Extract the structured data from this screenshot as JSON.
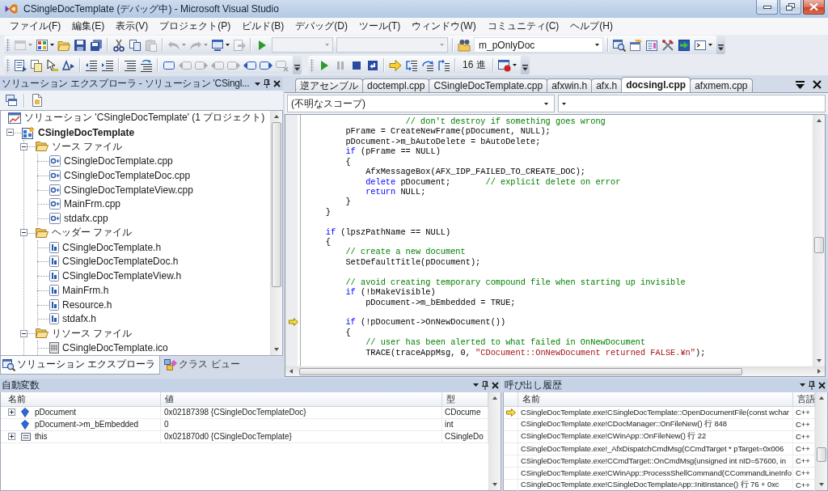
{
  "window": {
    "title": "CSingleDocTemplate (デバッグ中) - Microsoft Visual Studio"
  },
  "menu": [
    "ファイル(F)",
    "編集(E)",
    "表示(V)",
    "プロジェクト(P)",
    "ビルド(B)",
    "デバッグ(D)",
    "ツール(T)",
    "ウィンドウ(W)",
    "コミュニティ(C)",
    "ヘルプ(H)"
  ],
  "toolbar_rows": [
    {
      "toolbars": [
        {
          "items": [
            {
              "kind": "button",
              "disabled": true,
              "dropdown": true
            },
            {
              "kind": "button",
              "disabled": false,
              "dropdown": true
            },
            {
              "kind": "button",
              "disabled": false
            },
            {
              "kind": "button",
              "disabled": false
            },
            {
              "kind": "button",
              "disabled": false
            },
            {
              "kind": "separator"
            },
            {
              "kind": "button",
              "disabled": false
            },
            {
              "kind": "button",
              "disabled": false
            },
            {
              "kind": "button",
              "disabled": true
            },
            {
              "kind": "separator"
            },
            {
              "kind": "button",
              "disabled": true,
              "dropdown": true
            },
            {
              "kind": "button",
              "disabled": true,
              "dropdown": true
            },
            {
              "kind": "button",
              "disabled": false,
              "dropdown": true
            },
            {
              "kind": "button",
              "disabled": true
            },
            {
              "kind": "separator"
            },
            {
              "kind": "button",
              "disabled": false
            },
            {
              "kind": "combo",
              "disabled": true
            },
            {
              "kind": "combo",
              "disabled": true
            },
            {
              "kind": "separator"
            },
            {
              "kind": "button",
              "disabled": false
            },
            {
              "kind": "combo",
              "disabled": false,
              "value": "m_pOnlyDoc"
            },
            {
              "kind": "separator"
            },
            {
              "kind": "button",
              "disabled": false
            },
            {
              "kind": "button",
              "disabled": false
            },
            {
              "kind": "button",
              "disabled": false
            },
            {
              "kind": "button",
              "disabled": false
            },
            {
              "kind": "button",
              "disabled": false
            },
            {
              "kind": "button",
              "disabled": false,
              "dropdown": true
            }
          ]
        }
      ]
    },
    {
      "toolbars": [
        {
          "items": [
            {
              "kind": "button",
              "disabled": false
            },
            {
              "kind": "button",
              "disabled": false
            },
            {
              "kind": "button",
              "disabled": false
            },
            {
              "kind": "button",
              "disabled": false
            },
            {
              "kind": "separator"
            },
            {
              "kind": "button",
              "disabled": false
            },
            {
              "kind": "button",
              "disabled": false
            },
            {
              "kind": "separator"
            },
            {
              "kind": "button",
              "disabled": false
            },
            {
              "kind": "button",
              "disabled": false
            },
            {
              "kind": "separator"
            },
            {
              "kind": "button",
              "disabled": false
            },
            {
              "kind": "button",
              "disabled": true
            },
            {
              "kind": "button",
              "disabled": true
            },
            {
              "kind": "button",
              "disabled": true
            },
            {
              "kind": "button",
              "disabled": true
            },
            {
              "kind": "button",
              "disabled": false
            },
            {
              "kind": "button",
              "disabled": false
            },
            {
              "kind": "button",
              "disabled": true
            }
          ]
        },
        {
          "items": [
            {
              "kind": "button",
              "disabled": false
            },
            {
              "kind": "button",
              "disabled": true
            },
            {
              "kind": "button",
              "disabled": false
            },
            {
              "kind": "button",
              "disabled": false
            },
            {
              "kind": "separator"
            },
            {
              "kind": "button",
              "disabled": false
            },
            {
              "kind": "button",
              "disabled": false
            },
            {
              "kind": "button",
              "disabled": false
            },
            {
              "kind": "button",
              "disabled": false
            },
            {
              "kind": "separator"
            },
            {
              "kind": "text_button",
              "label": "16 進",
              "disabled": false
            },
            {
              "kind": "separator"
            },
            {
              "kind": "button",
              "disabled": false,
              "dropdown": true
            }
          ]
        }
      ]
    }
  ],
  "solution_explorer": {
    "title": "ソリューション エクスプローラ - ソリューション 'CSingl...",
    "tree": [
      {
        "label": "ソリューション 'CSingleDocTemplate' (1 プロジェクト)",
        "kind": "solution",
        "children": [
          {
            "label": "CSingleDocTemplate",
            "kind": "project",
            "expanded": true,
            "children": [
              {
                "label": "ソース ファイル",
                "kind": "folder",
                "expanded": true,
                "children": [
                  {
                    "label": "CSingleDocTemplate.cpp",
                    "kind": "source"
                  },
                  {
                    "label": "CSingleDocTemplateDoc.cpp",
                    "kind": "source"
                  },
                  {
                    "label": "CSingleDocTemplateView.cpp",
                    "kind": "source"
                  },
                  {
                    "label": "MainFrm.cpp",
                    "kind": "source"
                  },
                  {
                    "label": "stdafx.cpp",
                    "kind": "source"
                  }
                ]
              },
              {
                "label": "ヘッダー ファイル",
                "kind": "folder",
                "expanded": true,
                "children": [
                  {
                    "label": "CSingleDocTemplate.h",
                    "kind": "header"
                  },
                  {
                    "label": "CSingleDocTemplateDoc.h",
                    "kind": "header"
                  },
                  {
                    "label": "CSingleDocTemplateView.h",
                    "kind": "header"
                  },
                  {
                    "label": "MainFrm.h",
                    "kind": "header"
                  },
                  {
                    "label": "Resource.h",
                    "kind": "header"
                  },
                  {
                    "label": "stdafx.h",
                    "kind": "header"
                  }
                ]
              },
              {
                "label": "リソース ファイル",
                "kind": "folder",
                "expanded": true,
                "children": [
                  {
                    "label": "CSingleDocTemplate.ico",
                    "kind": "resource"
                  }
                ]
              }
            ]
          }
        ]
      }
    ],
    "tabs": [
      {
        "label": "ソリューション エクスプローラ",
        "selected": true
      },
      {
        "label": "クラス ビュー",
        "selected": false
      }
    ]
  },
  "editor": {
    "tabs": [
      {
        "label": "逆アセンブル",
        "selected": false
      },
      {
        "label": "doctempl.cpp",
        "selected": false
      },
      {
        "label": "CSingleDocTemplate.cpp",
        "selected": false
      },
      {
        "label": "afxwin.h",
        "selected": false
      },
      {
        "label": "afx.h",
        "selected": false
      },
      {
        "label": "docsingl.cpp",
        "selected": true
      },
      {
        "label": "afxmem.cpp",
        "selected": false
      }
    ],
    "scope": "(不明なスコープ)",
    "lines": [
      {
        "current": false,
        "parts": [
          {
            "kind": "comment",
            "text": "                    // don't destroy if something goes wrong"
          }
        ]
      },
      {
        "current": false,
        "parts": [
          {
            "kind": "code",
            "text": "        pFrame = CreateNewFrame(pDocument, NULL);"
          }
        ]
      },
      {
        "current": false,
        "parts": [
          {
            "kind": "code",
            "text": "        pDocument->m_bAutoDelete = bAutoDelete;"
          }
        ]
      },
      {
        "current": false,
        "parts": [
          {
            "kind": "keyword",
            "text": "        if"
          },
          {
            "kind": "code",
            "text": " (pFrame == NULL)"
          }
        ]
      },
      {
        "current": false,
        "parts": [
          {
            "kind": "code",
            "text": "        {"
          }
        ]
      },
      {
        "current": false,
        "parts": [
          {
            "kind": "code",
            "text": "            AfxMessageBox(AFX_IDP_FAILED_TO_CREATE_DOC);"
          }
        ]
      },
      {
        "current": false,
        "parts": [
          {
            "kind": "keyword",
            "text": "            delete"
          },
          {
            "kind": "code",
            "text": " pDocument;       "
          },
          {
            "kind": "comment",
            "text": "// explicit delete on error"
          }
        ]
      },
      {
        "current": false,
        "parts": [
          {
            "kind": "keyword",
            "text": "            return"
          },
          {
            "kind": "code",
            "text": " NULL;"
          }
        ]
      },
      {
        "current": false,
        "parts": [
          {
            "kind": "code",
            "text": "        }"
          }
        ]
      },
      {
        "current": false,
        "parts": [
          {
            "kind": "code",
            "text": "    }"
          }
        ]
      },
      {
        "current": false
      },
      {
        "current": false,
        "parts": [
          {
            "kind": "keyword",
            "text": "    if"
          },
          {
            "kind": "code",
            "text": " (lpszPathName == NULL)"
          }
        ]
      },
      {
        "current": false,
        "parts": [
          {
            "kind": "code",
            "text": "    {"
          }
        ]
      },
      {
        "current": false,
        "parts": [
          {
            "kind": "comment",
            "text": "        // create a new document"
          }
        ]
      },
      {
        "current": false,
        "parts": [
          {
            "kind": "code",
            "text": "        SetDefaultTitle(pDocument);"
          }
        ]
      },
      {
        "current": false
      },
      {
        "current": false,
        "parts": [
          {
            "kind": "comment",
            "text": "        // avoid creating temporary compound file when starting up invisible"
          }
        ]
      },
      {
        "current": false,
        "parts": [
          {
            "kind": "keyword",
            "text": "        if"
          },
          {
            "kind": "code",
            "text": " (!bMakeVisible)"
          }
        ]
      },
      {
        "current": false,
        "parts": [
          {
            "kind": "code",
            "text": "            pDocument->m_bEmbedded = TRUE;"
          }
        ]
      },
      {
        "current": false
      },
      {
        "current": true,
        "parts": [
          {
            "kind": "keyword",
            "text": "        if"
          },
          {
            "kind": "code",
            "text": " (!pDocument->OnNewDocument())"
          }
        ]
      },
      {
        "current": false,
        "parts": [
          {
            "kind": "code",
            "text": "        {"
          }
        ]
      },
      {
        "current": false,
        "parts": [
          {
            "kind": "comment",
            "text": "            // user has been alerted to what failed in OnNewDocument"
          }
        ]
      },
      {
        "current": false,
        "parts": [
          {
            "kind": "code",
            "text": "            TRACE(traceAppMsg, 0, "
          },
          {
            "kind": "string",
            "text": "\"CDocument::OnNewDocument returned FALSE.¥n\""
          },
          {
            "kind": "code",
            "text": ");"
          }
        ]
      }
    ]
  },
  "autos": {
    "title": "自動変数",
    "columns": [
      "名前",
      "値",
      "型"
    ],
    "rows": [
      {
        "name": "pDocument",
        "value": "0x02187398 {CSingleDocTemplateDoc}",
        "type": "CDocume",
        "kind": "variable",
        "expanded": false
      },
      {
        "name": "pDocument->m_bEmbedded",
        "value": "0",
        "type": "int",
        "kind": "variable"
      },
      {
        "name": "this",
        "value": "0x021870d0 {CSingleDocTemplate}",
        "type": "CSingleDo",
        "kind": "object",
        "expanded": false
      }
    ]
  },
  "call_stack": {
    "title": "呼び出し履歴",
    "columns": [
      "名前",
      "言語"
    ],
    "rows": [
      {
        "name": "CSingleDocTemplate.exe!CSingleDocTemplate::OpenDocumentFile(const wchar",
        "language": "C++",
        "current": true
      },
      {
        "name": "CSingleDocTemplate.exe!CDocManager::OnFileNew() 行 848",
        "language": "C++",
        "current": false
      },
      {
        "name": "CSingleDocTemplate.exe!CWinApp::OnFileNew() 行 22",
        "language": "C++",
        "current": false
      },
      {
        "name": "CSingleDocTemplate.exe!_AfxDispatchCmdMsg(CCmdTarget * pTarget=0x006",
        "language": "C++",
        "current": false
      },
      {
        "name": "CSingleDocTemplate.exe!CCmdTarget::OnCmdMsg(unsigned int nID=57600, in",
        "language": "C++",
        "current": false
      },
      {
        "name": "CSingleDocTemplate.exe!CWinApp::ProcessShellCommand(CCommandLineInfo",
        "language": "C++",
        "current": false
      },
      {
        "name": "CSingleDocTemplate.exe!CSingleDocTemplateApp::InitInstance() 行 76 + 0xc",
        "language": "C++",
        "current": false
      }
    ]
  }
}
